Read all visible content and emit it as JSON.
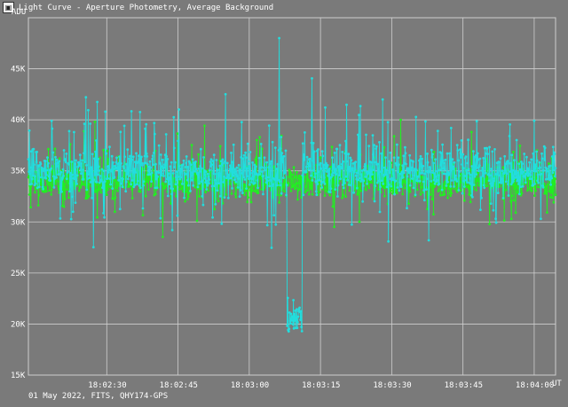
{
  "window": {
    "title": "Light Curve - Aperture Photometry, Average Background"
  },
  "footer": {
    "info": "01 May 2022, FITS, QHY174-GPS"
  },
  "colors": {
    "background": "#7a7a7a",
    "grid": "#cfcfcf",
    "target_series": "#22dddd",
    "comparison_series": "#22ee22",
    "text": "#ffffff"
  },
  "chart_data": {
    "type": "line",
    "title": "Light Curve - Aperture Photometry, Average Background",
    "xlabel": "UT",
    "ylabel": "ADU",
    "x_tick_labels": [
      "18:02:30",
      "18:02:45",
      "18:03:00",
      "18:03:15",
      "18:03:30",
      "18:03:45",
      "18:04:00"
    ],
    "y_tick_labels": [
      "15K",
      "20K",
      "25K",
      "30K",
      "35K",
      "40K",
      "45K"
    ],
    "y_ticks": [
      15000,
      20000,
      25000,
      30000,
      35000,
      40000,
      45000
    ],
    "ylim": [
      15000,
      50000
    ],
    "xlim_seconds_after_18_02": [
      13.5,
      124.5
    ],
    "x_tick_seconds_after_18_02": [
      30,
      45,
      60,
      75,
      90,
      105,
      120
    ],
    "grid": true,
    "series": [
      {
        "role": "target",
        "color": "#22dddd",
        "sample_interval_s": 0.1,
        "baseline_mean": 35000,
        "baseline_scatter_adu": 3000,
        "typical_range": [
          29000,
          41000
        ],
        "max_outlier": 48000,
        "occultation": {
          "start_s_after_18_02": 68.0,
          "end_s_after_18_02": 71.2,
          "level": 20500,
          "range": [
            17000,
            24000
          ]
        }
      },
      {
        "role": "comparison",
        "color": "#22ee22",
        "sample_interval_s": 0.1,
        "baseline_mean": 34000,
        "baseline_scatter_adu": 2200,
        "typical_range": [
          29000,
          39000
        ]
      }
    ]
  }
}
